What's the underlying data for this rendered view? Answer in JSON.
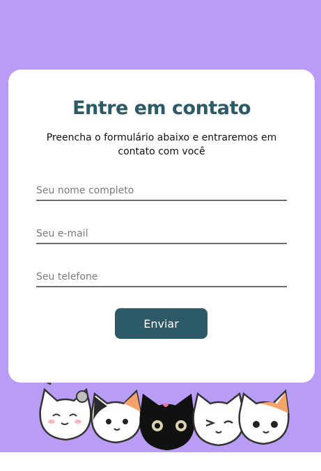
{
  "contact": {
    "title": "Entre em contato",
    "subtitle": "Preencha o formulário abaixo e entraremos em contato com você",
    "name_placeholder": "Seu nome completo",
    "email_placeholder": "Seu e-mail",
    "phone_placeholder": "Seu telefone",
    "submit_label": "Enviar"
  },
  "colors": {
    "background": "#b89cf6",
    "card": "#ffffff",
    "accent": "#2c5a66"
  },
  "illustration": {
    "icon": "cats-illustration"
  }
}
